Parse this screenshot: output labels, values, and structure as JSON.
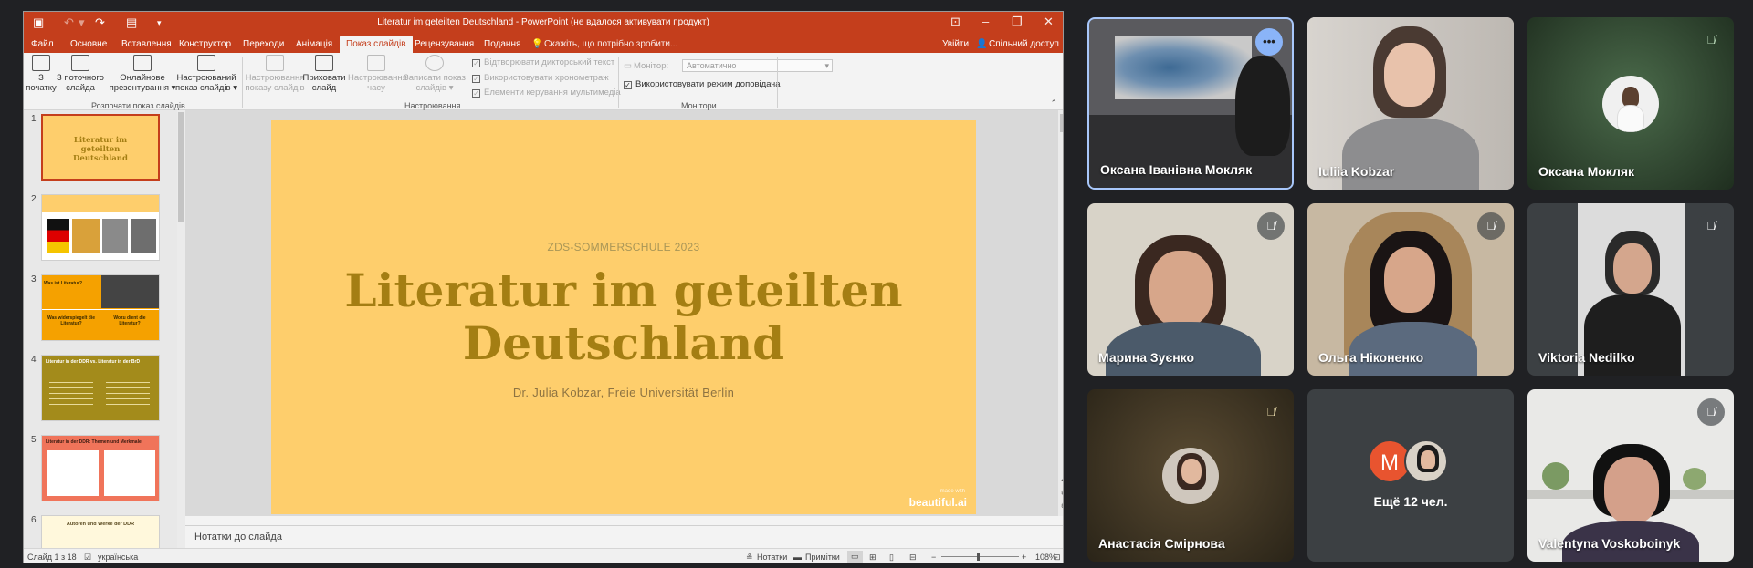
{
  "powerpoint": {
    "window_title": "Literatur im geteilten Deutschland - PowerPoint (не вдалося активувати продукт)",
    "menu_tabs": [
      "Файл",
      "Основне",
      "Вставлення",
      "Конструктор",
      "Переходи",
      "Анімація",
      "Показ слайдів",
      "Рецензування",
      "Подання"
    ],
    "active_tab": "Показ слайдів",
    "tell_me": "Скажіть, що потрібно зробити...",
    "sign_in": "Увійти",
    "share": "Спільний доступ",
    "ribbon": {
      "from_start": "З початку",
      "from_current": "З поточного слайда",
      "online_present": "Онлайнове презентування",
      "custom_show": "Настроюваний показ слайдів",
      "group_start": "Розпочати показ слайдів",
      "setup_show": "Настроювання показу слайдів",
      "hide_slide": "Приховати слайд",
      "rehearse": "Настроювання часу",
      "record_show": "Записати показ слайдів",
      "play_narrations": "Відтворювати дикторський текст",
      "use_timings": "Використовувати хронометраж",
      "media_controls": "Елементи керування мультимедіа",
      "group_setup": "Настроювання",
      "monitor_label": "Монітор:",
      "monitor_value": "Автоматично",
      "presenter_view": "Використовувати режим доповідача",
      "group_monitors": "Монітори"
    },
    "thumbnails": {
      "numbers": [
        "1",
        "2",
        "3",
        "4",
        "5",
        "6"
      ],
      "t1_title": "Literatur im geteilten Deutschland",
      "t3_q1": "Was ist Literatur?",
      "t3_q2": "Was widerspiegelt die Literatur?",
      "t3_q3": "Wozu dient die Literatur?",
      "t4_title": "Literatur in der DDR vs. Literatur in der BrD",
      "t5_title": "Literatur in der DDR: Themen und Merkmale",
      "t6_title": "Autoren und Werke der DDR"
    },
    "slide": {
      "subtitle": "ZDS-SOMMERSCHULE 2023",
      "title_line1": "Literatur im geteilten",
      "title_line2": "Deutschland",
      "author": "Dr. Julia Kobzar, Freie Universität Berlin",
      "brand": "beautiful.ai",
      "brand_small": "made with"
    },
    "notes_placeholder": "Нотатки до слайда",
    "status": {
      "slide_counter": "Слайд 1 з 18",
      "language": "українська",
      "notes_btn": "Нотатки",
      "comments_btn": "Примітки",
      "zoom": "108%"
    },
    "colors": {
      "accent": "#c43e1c",
      "slide_bg": "#fece6c",
      "title_color": "#a47e13"
    }
  },
  "meet": {
    "tiles": [
      {
        "name": "Оксана Іванівна Мокляк",
        "icon": "more-options-icon"
      },
      {
        "name": "Iuliia Kobzar"
      },
      {
        "name": "Оксана Мокляк",
        "icon": "mic-off-icon"
      },
      {
        "name": "Марина Зуєнко",
        "icon": "mic-off-icon"
      },
      {
        "name": "Ольга Ніконенко",
        "icon": "mic-off-icon"
      },
      {
        "name": "Viktoria Nedilko",
        "icon": "mic-off-icon"
      },
      {
        "name": "Анастасія Смірнова",
        "icon": "mic-off-icon"
      },
      {
        "name": "Valentyna Voskoboinyk",
        "icon": "mic-off-icon"
      }
    ],
    "others": {
      "initial": "M",
      "label": "Ещё 12 чел."
    }
  }
}
